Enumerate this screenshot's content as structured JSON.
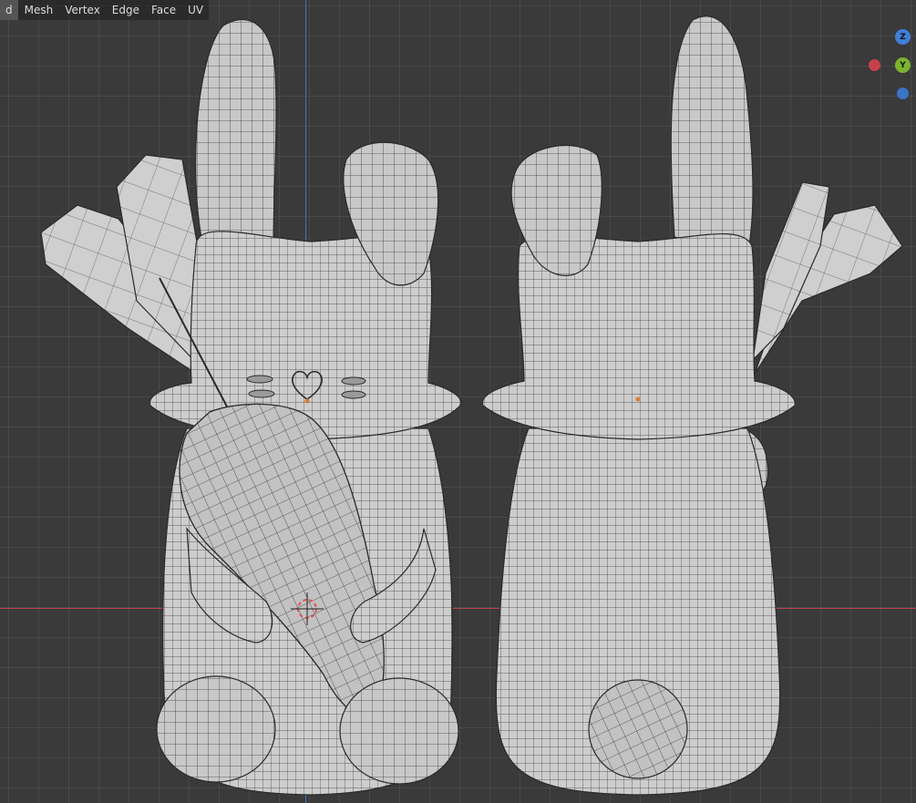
{
  "menu": {
    "items": [
      {
        "id": "view",
        "label": "d"
      },
      {
        "id": "mesh",
        "label": "Mesh"
      },
      {
        "id": "vertex",
        "label": "Vertex"
      },
      {
        "id": "edge",
        "label": "Edge"
      },
      {
        "id": "face",
        "label": "Face"
      },
      {
        "id": "uv",
        "label": "UV"
      }
    ]
  },
  "gizmo": {
    "z_label": "Z",
    "y_label": "Y",
    "colors": {
      "x": "#c8404a",
      "y": "#7bb32e",
      "z": "#3f7fd6"
    }
  },
  "viewport": {
    "grid_color": "#3a3a3a",
    "x_axis_color": "#b8434c",
    "z_axis_color": "#3d7ab8",
    "mesh_color": "#c9c9c9"
  }
}
